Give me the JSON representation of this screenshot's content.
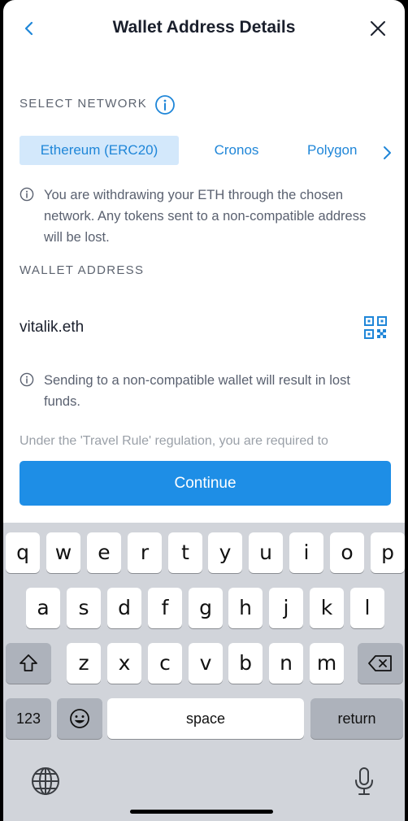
{
  "header": {
    "title": "Wallet Address Details",
    "back_icon": "chevron-left-icon",
    "close_icon": "close-icon"
  },
  "network": {
    "label": "SELECT NETWORK",
    "tabs": [
      {
        "label": "Ethereum (ERC20)",
        "selected": true
      },
      {
        "label": "Cronos",
        "selected": false
      },
      {
        "label": "Polygon",
        "selected": false
      }
    ],
    "notice": "You are withdrawing your ETH through the chosen network. Any tokens sent to a non-compatible address will be lost."
  },
  "wallet": {
    "label": "WALLET ADDRESS",
    "value": "vitalik.eth",
    "warning": "Sending to a non-compatible wallet will result in lost funds.",
    "travel_rule_text": "Under the 'Travel Rule' regulation, you are required to"
  },
  "continue_label": "Continue",
  "keyboard": {
    "row1": [
      "q",
      "w",
      "e",
      "r",
      "t",
      "y",
      "u",
      "i",
      "o",
      "p"
    ],
    "row2": [
      "a",
      "s",
      "d",
      "f",
      "g",
      "h",
      "j",
      "k",
      "l"
    ],
    "row3": [
      "z",
      "x",
      "c",
      "v",
      "b",
      "n",
      "m"
    ],
    "numbers_label": "123",
    "space_label": "space",
    "return_label": "return"
  },
  "colors": {
    "accent": "#1e8ee6",
    "tab_selected_bg": "#d3e8fb",
    "keyboard_bg": "#d1d4da"
  }
}
